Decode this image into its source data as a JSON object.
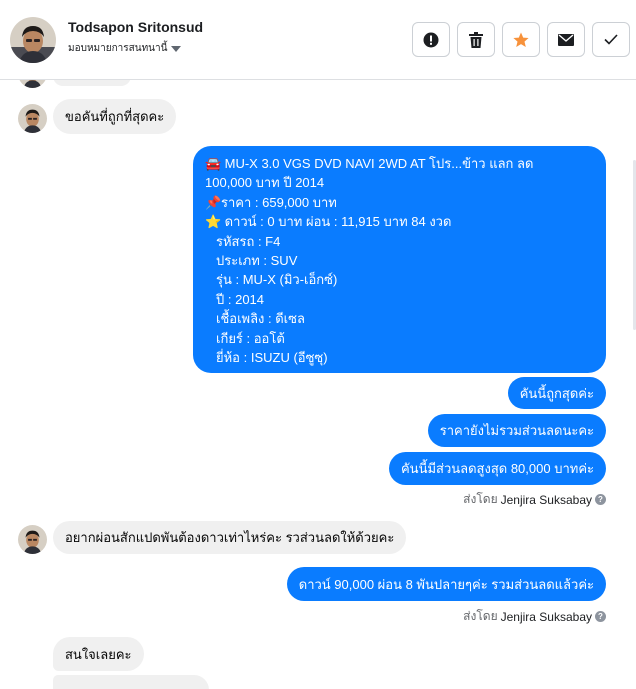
{
  "header": {
    "contact_name": "Todsapon Sritonsud",
    "assign_label": "มอบหมายการสนทนานี้",
    "actions": [
      {
        "name": "report-button",
        "icon": "alert-circle-icon"
      },
      {
        "name": "delete-button",
        "icon": "trash-icon"
      },
      {
        "name": "star-button",
        "icon": "star-icon"
      },
      {
        "name": "mark-unread-button",
        "icon": "envelope-icon"
      },
      {
        "name": "mark-done-button",
        "icon": "checkmark-icon"
      }
    ]
  },
  "colors": {
    "outgoing_bubble": "#0a7cff",
    "incoming_bubble": "#f0f0f0",
    "star": "#f7923b"
  },
  "messages": {
    "m1": "ขอคันที่ถูกที่สุดคะ",
    "listing": {
      "title_line1": "MU-X 3.0 VGS DVD NAVI 2WD AT โปร...ข้าว แลก ลด",
      "title_line2": "100,000 บาท ปี 2014",
      "price": "ราคา : 659,000 บาท",
      "down": "ดาวน์ : 0 บาท ผ่อน : 11,915 บาท 84 งวด",
      "code": "รหัสรถ : F4",
      "type": "ประเภท : SUV",
      "model": "รุ่น : MU-X (มิว-เอ็กซ์)",
      "year": "ปี : 2014",
      "fuel": "เชื้อเพลิง : ดีเซล",
      "gear": "เกียร์ : ออโต้",
      "brand": "ยี่ห้อ : ISUZU (อีซูซุ)",
      "car_emoji": "🚘",
      "pin_emoji": "📌",
      "star_emoji": "⭐"
    },
    "r1": "คันนี้ถูกสุดค่ะ",
    "r2": "ราคายังไม่รวมส่วนลดนะคะ",
    "r3": "คันนี้มีส่วนลดสูงสุด 80,000 บาทค่ะ",
    "sent_by_label": "ส่งโดย",
    "sent_by_name": "Jenjira Suksabay",
    "help_glyph": "?",
    "m2": "อยากผ่อนสักแปดพันต้องดาวเท่าไหร่คะ  รวส่วนลดให้ด้วยคะ",
    "r4": "ดาวน์ 90,000 ผ่อน 8 พันปลายๆค่ะ รวมส่วนลดแล้วค่ะ",
    "m3": "สนใจเลยคะ"
  }
}
